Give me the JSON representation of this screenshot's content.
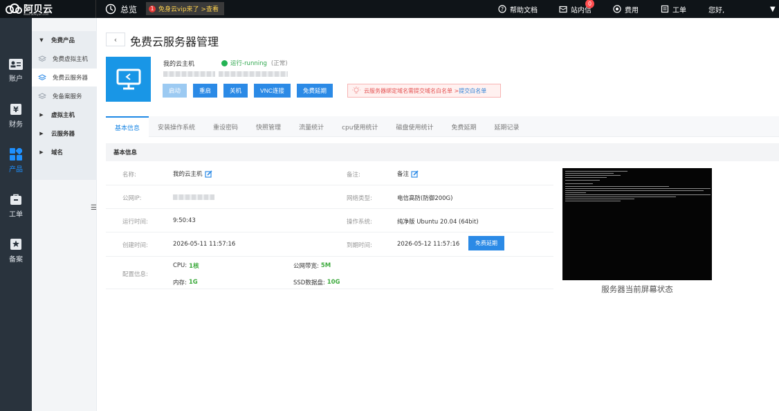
{
  "topbar": {
    "logo_text": "阿贝云",
    "logo_url": "www.abeiyun.com",
    "overview": "总览",
    "promo_count": "1",
    "promo_text": "免身云vip来了 >查看",
    "help": "帮助文档",
    "messages": "站内信",
    "messages_badge": "0",
    "fees": "费用",
    "tickets": "工单",
    "greeting": "您好,"
  },
  "left_nav": {
    "items": [
      {
        "label": "账户"
      },
      {
        "label": "财务"
      },
      {
        "label": "产品"
      },
      {
        "label": "工单"
      },
      {
        "label": "备案"
      }
    ]
  },
  "sub_nav": {
    "group_free": "免费产品",
    "free_vhost": "免费虚拟主机",
    "free_server": "免费云服务器",
    "free_record": "免备案服务",
    "group_vhost": "虚拟主机",
    "group_cloud": "云服务器",
    "group_domain": "域名"
  },
  "page": {
    "title": "免费云服务器管理",
    "host_name": "我的云主机",
    "status_text": "运行-running",
    "status_note": "(正常)",
    "accent_color": "#2b8ae6",
    "actions": {
      "start": "启动",
      "restart": "重启",
      "shutdown": "关机",
      "vnc": "VNC连接",
      "extend": "免费延期"
    },
    "notice_text": "云服务器绑定域名需提交域名白名单 >",
    "notice_link": "提交白名单"
  },
  "tabs": [
    "基本信息",
    "安装操作系统",
    "重设密码",
    "快照管理",
    "流量统计",
    "cpu使用统计",
    "磁盘使用统计",
    "免费延期",
    "延期记录"
  ],
  "basic_info": {
    "section_title": "基本信息",
    "name_label": "名称:",
    "name_value": "我的云主机",
    "remark_label": "备注:",
    "remark_value": "备注",
    "ip_label": "公网IP:",
    "net_label": "网络类型:",
    "net_value": "电信高防(防御200G)",
    "uptime_label": "运行时间:",
    "uptime_value": "9:50:43",
    "os_label": "操作系统:",
    "os_value": "纯净版 Ubuntu 20.04 (64bit)",
    "created_label": "创建时间:",
    "created_value": "2026-05-11 11:57:16",
    "expire_label": "到期时间:",
    "expire_value": "2026-05-12 11:57:16",
    "extend_btn": "免费延期",
    "config_label": "配置信息:",
    "cpu_label": "CPU:",
    "cpu_value": "1核",
    "bandwidth_label": "公网带宽:",
    "bandwidth_value": "5M",
    "mem_label": "内存:",
    "mem_value": "1G",
    "disk_label": "SSD数据盘:",
    "disk_value": "10G"
  },
  "screen_caption": "服务器当前屏幕状态"
}
